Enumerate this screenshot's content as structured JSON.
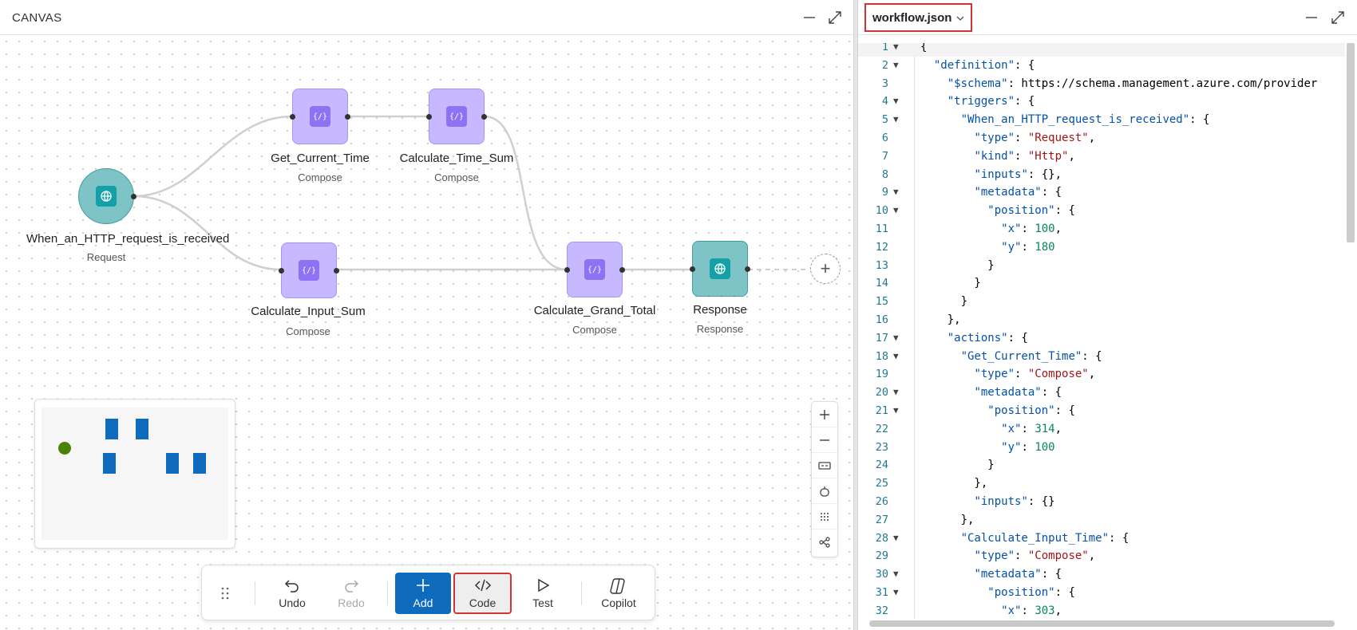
{
  "canvas": {
    "title": "CANVAS",
    "minimize_label": "—",
    "maximize_label": "⤢",
    "add_node_label": "+",
    "nodes": [
      {
        "name": "When_an_HTTP_request_is_received",
        "type": "Request"
      },
      {
        "name": "Get_Current_Time",
        "type": "Compose"
      },
      {
        "name": "Calculate_Time_Sum",
        "type": "Compose"
      },
      {
        "name": "Calculate_Input_Sum",
        "type": "Compose"
      },
      {
        "name": "Calculate_Grand_Total",
        "type": "Compose"
      },
      {
        "name": "Response",
        "type": "Response"
      }
    ],
    "zoom_controls": [
      "zoom-in",
      "zoom-out",
      "fit-view",
      "pan-mode",
      "minimap-toggle",
      "layout"
    ],
    "toolbar": {
      "undo": "Undo",
      "redo": "Redo",
      "add": "Add",
      "code": "Code",
      "test": "Test",
      "copilot": "Copilot"
    }
  },
  "code_pane": {
    "file_name": "workflow.json",
    "current_line": 1,
    "lines": [
      {
        "n": "1",
        "fold": true,
        "t": "{"
      },
      {
        "n": "2",
        "fold": true,
        "t": "  \"definition\": {"
      },
      {
        "n": "3",
        "fold": false,
        "t": "    \"$schema\": \"https://schema.management.azure.com/provider"
      },
      {
        "n": "4",
        "fold": true,
        "t": "    \"triggers\": {"
      },
      {
        "n": "5",
        "fold": true,
        "t": "      \"When_an_HTTP_request_is_received\": {"
      },
      {
        "n": "6",
        "fold": false,
        "t": "        \"type\": \"Request\","
      },
      {
        "n": "7",
        "fold": false,
        "t": "        \"kind\": \"Http\","
      },
      {
        "n": "8",
        "fold": false,
        "t": "        \"inputs\": {},"
      },
      {
        "n": "9",
        "fold": true,
        "t": "        \"metadata\": {"
      },
      {
        "n": "10",
        "fold": true,
        "t": "          \"position\": {"
      },
      {
        "n": "11",
        "fold": false,
        "t": "            \"x\": 100,"
      },
      {
        "n": "12",
        "fold": false,
        "t": "            \"y\": 180"
      },
      {
        "n": "13",
        "fold": false,
        "t": "          }"
      },
      {
        "n": "14",
        "fold": false,
        "t": "        }"
      },
      {
        "n": "15",
        "fold": false,
        "t": "      }"
      },
      {
        "n": "16",
        "fold": false,
        "t": "    },"
      },
      {
        "n": "17",
        "fold": true,
        "t": "    \"actions\": {"
      },
      {
        "n": "18",
        "fold": true,
        "t": "      \"Get_Current_Time\": {"
      },
      {
        "n": "19",
        "fold": false,
        "t": "        \"type\": \"Compose\","
      },
      {
        "n": "20",
        "fold": true,
        "t": "        \"metadata\": {"
      },
      {
        "n": "21",
        "fold": true,
        "t": "          \"position\": {"
      },
      {
        "n": "22",
        "fold": false,
        "t": "            \"x\": 314,"
      },
      {
        "n": "23",
        "fold": false,
        "t": "            \"y\": 100"
      },
      {
        "n": "24",
        "fold": false,
        "t": "          }"
      },
      {
        "n": "25",
        "fold": false,
        "t": "        },"
      },
      {
        "n": "26",
        "fold": false,
        "t": "        \"inputs\": {}"
      },
      {
        "n": "27",
        "fold": false,
        "t": "      },"
      },
      {
        "n": "28",
        "fold": true,
        "t": "      \"Calculate_Input_Time\": {"
      },
      {
        "n": "29",
        "fold": false,
        "t": "        \"type\": \"Compose\","
      },
      {
        "n": "30",
        "fold": true,
        "t": "        \"metadata\": {"
      },
      {
        "n": "31",
        "fold": true,
        "t": "          \"position\": {"
      },
      {
        "n": "32",
        "fold": false,
        "t": "            \"x\": 303,"
      }
    ]
  }
}
